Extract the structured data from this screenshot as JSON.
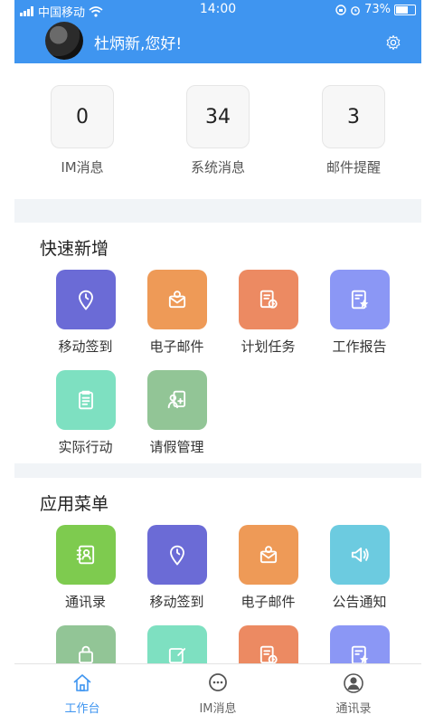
{
  "status_bar": {
    "carrier": "中国移动",
    "time": "14:00",
    "battery": "73%",
    "battery_fraction": 0.73
  },
  "header": {
    "greeting": "杜炳新,您好!"
  },
  "stats": [
    {
      "value": "0",
      "label": "IM消息"
    },
    {
      "value": "34",
      "label": "系统消息"
    },
    {
      "value": "3",
      "label": "邮件提醒"
    }
  ],
  "quick_add": {
    "title": "快速新增",
    "items": [
      {
        "label": "移动签到",
        "color": "#6b6bd6",
        "icon": "location-icon"
      },
      {
        "label": "电子邮件",
        "color": "#ee9a57",
        "icon": "mail-icon"
      },
      {
        "label": "计划任务",
        "color": "#ec8a62",
        "icon": "task-icon"
      },
      {
        "label": "工作报告",
        "color": "#8b97f5",
        "icon": "report-icon"
      },
      {
        "label": "实际行动",
        "color": "#7ee0c1",
        "icon": "clipboard-icon"
      },
      {
        "label": "请假管理",
        "color": "#92c596",
        "icon": "leave-icon"
      }
    ]
  },
  "app_menu": {
    "title": "应用菜单",
    "items": [
      {
        "label": "通讯录",
        "color": "#7ecb4f",
        "icon": "contacts-icon"
      },
      {
        "label": "移动签到",
        "color": "#6b6bd6",
        "icon": "location-icon"
      },
      {
        "label": "电子邮件",
        "color": "#ee9a57",
        "icon": "mail-icon"
      },
      {
        "label": "公告通知",
        "color": "#6ccbe0",
        "icon": "speaker-icon"
      },
      {
        "label": "",
        "color": "#92c596",
        "icon": "bag-icon"
      },
      {
        "label": "",
        "color": "#7ee0c1",
        "icon": "edit-icon"
      },
      {
        "label": "",
        "color": "#ec8a62",
        "icon": "task-icon"
      },
      {
        "label": "",
        "color": "#8b97f5",
        "icon": "report-icon"
      }
    ]
  },
  "tabbar": [
    {
      "label": "工作台",
      "icon": "home-icon",
      "active": true
    },
    {
      "label": "IM消息",
      "icon": "chat-icon",
      "active": false
    },
    {
      "label": "通讯录",
      "icon": "person-icon",
      "active": false
    }
  ]
}
